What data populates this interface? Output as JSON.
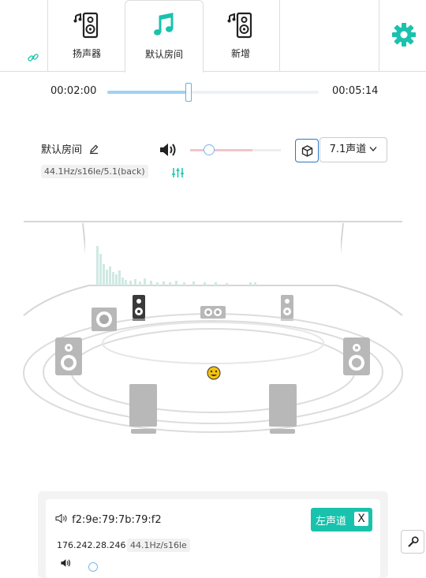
{
  "tabs": [
    {
      "label": "扬声器",
      "icon": "speaker-icon",
      "active": false
    },
    {
      "label": "默认房间",
      "icon": "music-note-icon",
      "active": true
    },
    {
      "label": "新增",
      "icon": "speaker-icon",
      "active": false
    }
  ],
  "colors": {
    "accent": "#19c2ad",
    "progress": "#9fd3f0",
    "volume": "#f2c4c9",
    "select_border": "#2d78c2"
  },
  "player": {
    "current_time": "00:02:00",
    "total_time": "00:05:14",
    "progress_fraction": 0.38
  },
  "room": {
    "name": "默认房间",
    "format": "44.1Hz/s16le/5.1(back)",
    "volume_fraction": 0.2,
    "channel_mode": "7.1声道"
  },
  "device_card": {
    "mac": "f2:9e:79:7b:79:f2",
    "ip": "176.242.28.246",
    "format": "44.1Hz/s16le",
    "channel_label": "左声道",
    "remove_label": "X"
  }
}
